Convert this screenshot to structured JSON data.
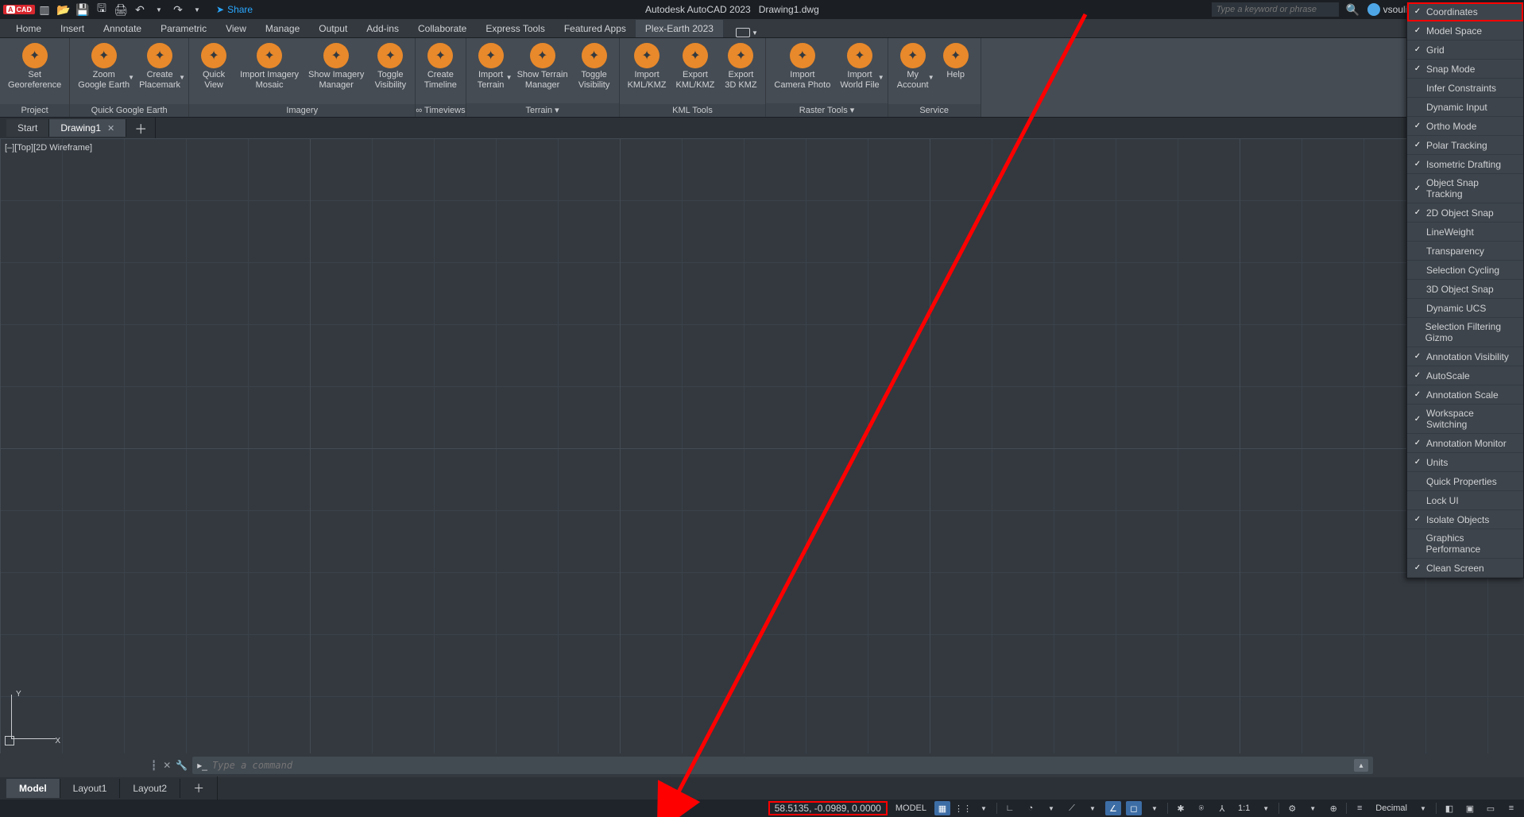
{
  "title": {
    "app": "Autodesk AutoCAD 2023",
    "file": "Drawing1.dwg"
  },
  "share_label": "Share",
  "search_placeholder": "Type a keyword or phrase",
  "username": "vsoulioti",
  "menutabs": [
    "Home",
    "Insert",
    "Annotate",
    "Parametric",
    "View",
    "Manage",
    "Output",
    "Add-ins",
    "Collaborate",
    "Express Tools",
    "Featured Apps",
    "Plex-Earth 2023"
  ],
  "active_menu_index": 11,
  "ribbon": {
    "panels": [
      {
        "title": "Project",
        "buttons": [
          {
            "label": "Set\nGeoreference"
          }
        ]
      },
      {
        "title": "Quick Google Earth",
        "buttons": [
          {
            "label": "Zoom\nGoogle Earth",
            "dd": true
          },
          {
            "label": "Create\nPlacemark",
            "dd": true
          }
        ]
      },
      {
        "title": "Imagery",
        "buttons": [
          {
            "label": "Quick\nView"
          },
          {
            "label": "Import Imagery\nMosaic"
          },
          {
            "label": "Show Imagery\nManager"
          },
          {
            "label": "Toggle\nVisibility"
          }
        ]
      },
      {
        "title": "∞ Timeviews",
        "buttons": [
          {
            "label": "Create\nTimeline"
          }
        ]
      },
      {
        "title": "Terrain ▾",
        "buttons": [
          {
            "label": "Import\nTerrain",
            "dd": true
          },
          {
            "label": "Show Terrain\nManager"
          },
          {
            "label": "Toggle\nVisibility"
          }
        ]
      },
      {
        "title": "KML Tools",
        "buttons": [
          {
            "label": "Import\nKML/KMZ"
          },
          {
            "label": "Export\nKML/KMZ"
          },
          {
            "label": "Export\n3D KMZ"
          }
        ]
      },
      {
        "title": "Raster Tools ▾",
        "buttons": [
          {
            "label": "Import\nCamera Photo"
          },
          {
            "label": "Import\nWorld File",
            "dd": true
          }
        ]
      },
      {
        "title": "Service",
        "buttons": [
          {
            "label": "My\nAccount",
            "dd": true
          },
          {
            "label": "Help"
          }
        ]
      }
    ]
  },
  "doctabs": {
    "start": "Start",
    "drawing": "Drawing1"
  },
  "viewport_label": "[–][Top][2D Wireframe]",
  "ucs": {
    "y": "Y",
    "x": "X"
  },
  "cmd_placeholder": "Type a command",
  "layout_tabs": [
    "Model",
    "Layout1",
    "Layout2"
  ],
  "status": {
    "coords": "58.5135, -0.0989, 0.0000",
    "model": "MODEL",
    "scale": "1:1",
    "units": "Decimal"
  },
  "ctx_items": [
    {
      "label": "Coordinates",
      "checked": true,
      "hl": true
    },
    {
      "label": "Model Space",
      "checked": true
    },
    {
      "label": "Grid",
      "checked": true
    },
    {
      "label": "Snap Mode",
      "checked": true
    },
    {
      "label": "Infer Constraints",
      "checked": false
    },
    {
      "label": "Dynamic Input",
      "checked": false
    },
    {
      "label": "Ortho Mode",
      "checked": true
    },
    {
      "label": "Polar Tracking",
      "checked": true
    },
    {
      "label": "Isometric Drafting",
      "checked": true
    },
    {
      "label": "Object Snap Tracking",
      "checked": true
    },
    {
      "label": "2D Object Snap",
      "checked": true
    },
    {
      "label": "LineWeight",
      "checked": false
    },
    {
      "label": "Transparency",
      "checked": false
    },
    {
      "label": "Selection Cycling",
      "checked": false
    },
    {
      "label": "3D Object Snap",
      "checked": false
    },
    {
      "label": "Dynamic UCS",
      "checked": false
    },
    {
      "label": "Selection Filtering Gizmo",
      "checked": false
    },
    {
      "label": "Annotation Visibility",
      "checked": true
    },
    {
      "label": "AutoScale",
      "checked": true
    },
    {
      "label": "Annotation Scale",
      "checked": true
    },
    {
      "label": "Workspace Switching",
      "checked": true
    },
    {
      "label": "Annotation Monitor",
      "checked": true
    },
    {
      "label": "Units",
      "checked": true
    },
    {
      "label": "Quick Properties",
      "checked": false
    },
    {
      "label": "Lock UI",
      "checked": false
    },
    {
      "label": "Isolate Objects",
      "checked": true
    },
    {
      "label": "Graphics Performance",
      "checked": false
    },
    {
      "label": "Clean Screen",
      "checked": true
    }
  ]
}
